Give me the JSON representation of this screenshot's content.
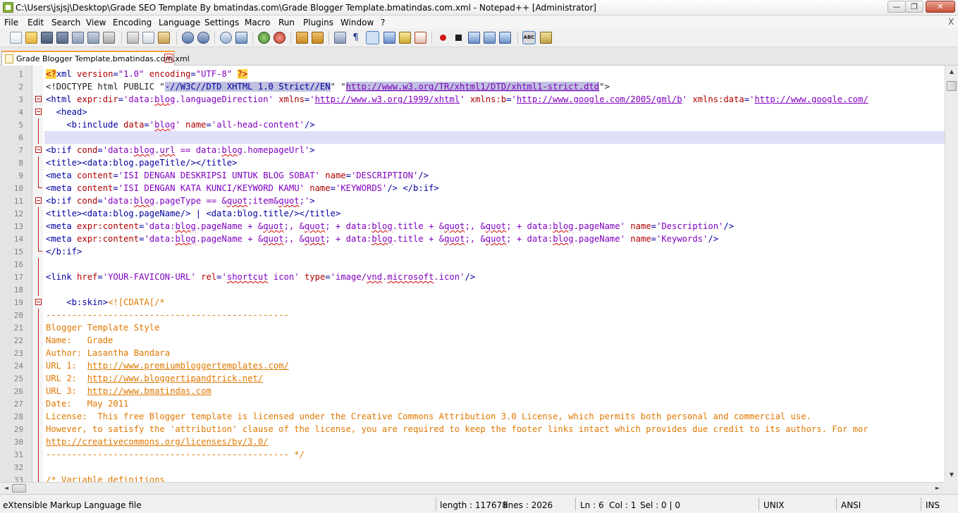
{
  "window": {
    "title": "C:\\Users\\jsjsj\\Desktop\\Grade SEO  Template By bmatindas.com\\Grade Blogger Template.bmatindas.com.xml - Notepad++ [Administrator]",
    "min_glyph": "—",
    "max_glyph": "❐",
    "close_glyph": "✕"
  },
  "menu": {
    "items": [
      "File",
      "Edit",
      "Search",
      "View",
      "Encoding",
      "Language",
      "Settings",
      "Macro",
      "Run",
      "Plugins",
      "Window",
      "?"
    ],
    "close_x": "X"
  },
  "toolbar": {
    "icons": [
      "new-file-icon",
      "open-file-icon",
      "save-icon",
      "save-all-icon",
      "close-icon",
      "close-all-icon",
      "print-icon",
      "cut-icon",
      "copy-icon",
      "paste-icon",
      "undo-icon",
      "redo-icon",
      "find-icon",
      "replace-icon",
      "zoom-in-icon",
      "zoom-out-icon",
      "sync-vertical-icon",
      "sync-horizontal-icon",
      "word-wrap-icon",
      "show-all-chars-icon",
      "indent-guide-icon",
      "user-language-icon",
      "doc-map-icon",
      "function-list-icon",
      "record-macro-icon",
      "stop-macro-icon",
      "play-macro-icon",
      "play-multiple-icon",
      "save-macro-icon",
      "spell-check-icon",
      "spell-settings-icon"
    ]
  },
  "tab": {
    "label": "Grade Blogger Template.bmatindas.com.xml",
    "close_glyph": "✕"
  },
  "editor": {
    "current_line": 6,
    "lines": [
      {
        "n": "1",
        "fold": ""
      },
      {
        "n": "2",
        "fold": ""
      },
      {
        "n": "3",
        "fold": "box"
      },
      {
        "n": "4",
        "fold": "box"
      },
      {
        "n": "5",
        "fold": "vline"
      },
      {
        "n": "6",
        "fold": "vline"
      },
      {
        "n": "7",
        "fold": "box"
      },
      {
        "n": "8",
        "fold": "vline"
      },
      {
        "n": "9",
        "fold": "vline"
      },
      {
        "n": "10",
        "fold": "end"
      },
      {
        "n": "11",
        "fold": "box"
      },
      {
        "n": "12",
        "fold": "vline"
      },
      {
        "n": "13",
        "fold": "vline"
      },
      {
        "n": "14",
        "fold": "vline"
      },
      {
        "n": "15",
        "fold": "end"
      },
      {
        "n": "16",
        "fold": "vline"
      },
      {
        "n": "17",
        "fold": "vline"
      },
      {
        "n": "18",
        "fold": "vline"
      },
      {
        "n": "19",
        "fold": "box"
      },
      {
        "n": "20",
        "fold": "vline"
      },
      {
        "n": "21",
        "fold": "vline"
      },
      {
        "n": "22",
        "fold": "vline"
      },
      {
        "n": "23",
        "fold": "vline"
      },
      {
        "n": "24",
        "fold": "vline"
      },
      {
        "n": "25",
        "fold": "vline"
      },
      {
        "n": "26",
        "fold": "vline"
      },
      {
        "n": "27",
        "fold": "vline"
      },
      {
        "n": "28",
        "fold": "vline"
      },
      {
        "n": "29",
        "fold": "vline"
      },
      {
        "n": "30",
        "fold": "vline"
      },
      {
        "n": "31",
        "fold": "vline"
      },
      {
        "n": "32",
        "fold": "vline"
      },
      {
        "n": "33",
        "fold": "vline"
      }
    ],
    "code": {
      "l1": [
        "<?",
        "xml ",
        "version",
        "=",
        "\"1.0\"",
        " ",
        "encoding",
        "=",
        "\"UTF-8\"",
        " ",
        "?>"
      ],
      "l2": [
        "<!DOCTYPE html PUBLIC \"",
        "-//W3C//DTD XHTML 1.0 Strict//EN",
        "\" \"",
        "http://www.w3.org/TR/xhtml1/DTD/xhtml1-strict.dtd",
        "\">"
      ],
      "l3": [
        "<html ",
        "expr:dir",
        "=",
        "'data:",
        "blog",
        ".languageDirection'",
        " ",
        "xmlns",
        "=",
        "'",
        "http://www.w3.org/1999/xhtml",
        "'",
        " ",
        "xmlns:b",
        "=",
        "'",
        "http://www.google.com/2005/gml/b",
        "'",
        " ",
        "xmlns:data",
        "=",
        "'",
        "http://www.google.com/"
      ],
      "l4": [
        "  <head>"
      ],
      "l5": [
        "    <b:include ",
        "data",
        "=",
        "'",
        "blog",
        "'",
        " ",
        "name",
        "=",
        "'all-head-content'",
        "/>"
      ],
      "l6": [
        ""
      ],
      "l7": [
        "<b:if ",
        "cond",
        "=",
        "'data:",
        "blog",
        ".",
        "url",
        " == data:",
        "blog",
        ".homepageUrl'",
        ">"
      ],
      "l8": [
        "<title><data:blog.pageTitle/></title>"
      ],
      "l9": [
        "<meta ",
        "content",
        "=",
        "'ISI DENGAN DESKRIPSI UNTUK BLOG SOBAT'",
        " ",
        "name",
        "=",
        "'DESCRIPTION'",
        "/>"
      ],
      "l10": [
        "<meta ",
        "content",
        "=",
        "'ISI DENGAN KATA KUNCI/KEYWORD KAMU'",
        " ",
        "name",
        "=",
        "'KEYWORDS'",
        "/> </b:if>"
      ],
      "l11": [
        "<b:if ",
        "cond",
        "=",
        "'data:",
        "blog",
        ".pageType == &",
        "quot",
        ";item&",
        "quot",
        ";'",
        ">"
      ],
      "l12": [
        "<title><data:blog.pageName/> | <data:blog.title/></title>"
      ],
      "l13": [
        "<meta ",
        "expr:content",
        "=",
        "'data:",
        "blog",
        ".pageName + &",
        "quot",
        ";, &",
        "quot",
        "; + data:",
        "blog",
        ".title + &",
        "quot",
        ";, &",
        "quot",
        "; + data:",
        "blog",
        ".pageName'",
        " ",
        "name",
        "=",
        "'Description'",
        "/>"
      ],
      "l14": [
        "<meta ",
        "expr:content",
        "=",
        "'data:",
        "blog",
        ".pageName + &",
        "quot",
        ";, &",
        "quot",
        "; + data:",
        "blog",
        ".title + &",
        "quot",
        ";, &",
        "quot",
        "; + data:",
        "blog",
        ".pageName'",
        " ",
        "name",
        "=",
        "'Keywords'",
        "/>"
      ],
      "l15": [
        "</b:if>"
      ],
      "l16": [
        ""
      ],
      "l17": [
        "<link ",
        "href",
        "=",
        "'YOUR-FAVICON-URL'",
        " ",
        "rel",
        "=",
        "'",
        "shortcut",
        " icon'",
        " ",
        "type",
        "=",
        "'image/",
        "vnd",
        ".",
        "microsoft",
        ".icon'",
        "/>"
      ],
      "l18": [
        ""
      ],
      "l19": [
        "    <b:skin>",
        "<![CDATA[/*"
      ],
      "l20": "-----------------------------------------------",
      "l21": "Blogger Template Style",
      "l22": "Name:   Grade",
      "l23": "Author: Lasantha Bandara",
      "l24": [
        "URL 1:  ",
        "http://www.premiumbloggertemplates.com/"
      ],
      "l25": [
        "URL 2:  ",
        "http://www.bloggertipandtrick.net/"
      ],
      "l26": [
        "URL 3:  ",
        "http://www.bmatindas.com"
      ],
      "l27": "Date:   May 2011",
      "l28": "License:  This free Blogger template is licensed under the Creative Commons Attribution 3.0 License, which permits both personal and commercial use.",
      "l29": "However, to satisfy the 'attribution' clause of the license, you are required to keep the footer links intact which provides due credit to its authors. For mor",
      "l30": [
        "",
        "http://creativecommons.org/licenses/by/3.0/"
      ],
      "l31": "----------------------------------------------- */",
      "l32": "",
      "l33": "/* Variable definitions"
    }
  },
  "scrollbars": {
    "up": "▲",
    "down": "▼",
    "left": "◄",
    "right": "►"
  },
  "status": {
    "file_type": "eXtensible Markup Language file",
    "length": "length : 117678",
    "lines": "lines : 2026",
    "ln": "Ln : 6",
    "col": "Col : 1",
    "sel": "Sel : 0 | 0",
    "eol": "UNIX",
    "encoding": "ANSI",
    "mode": "INS"
  },
  "colors": {
    "tag": "#0000a0",
    "attribute": "#b00000",
    "value": "#8000c0",
    "cdata": "#e07800",
    "current_line": "#e0e0f8",
    "tab_accent": "#f5a03c"
  }
}
